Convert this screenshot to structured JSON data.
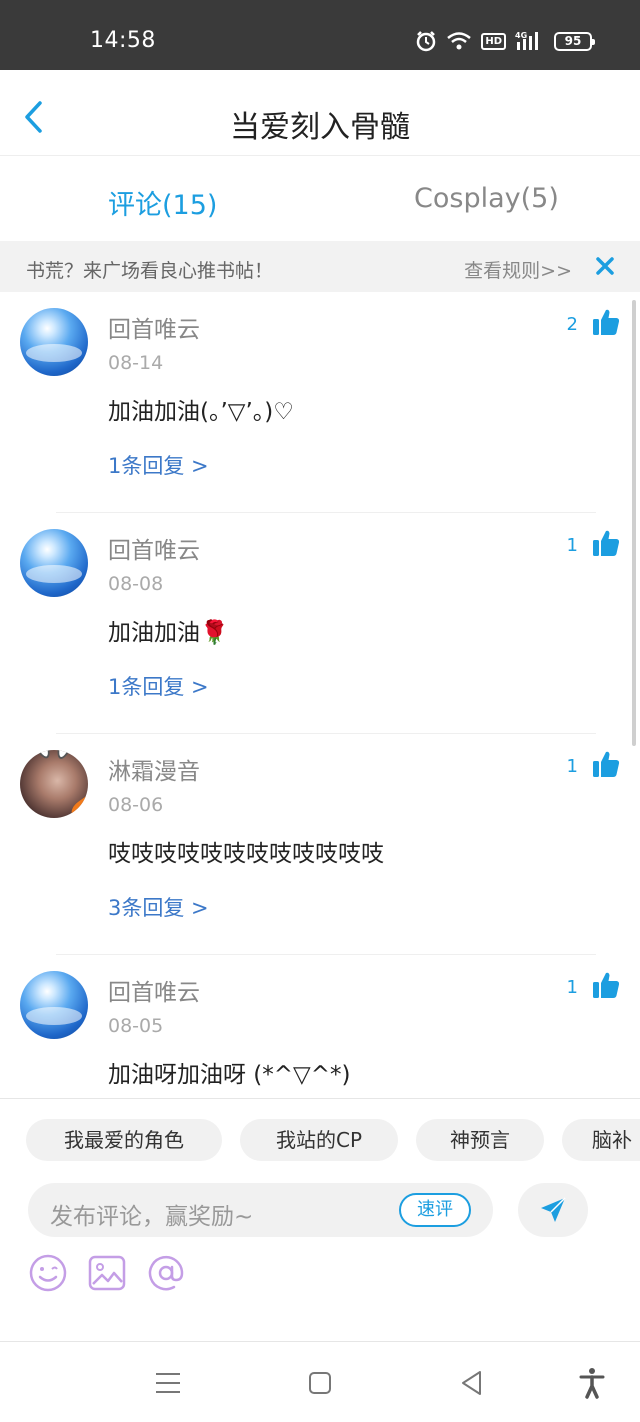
{
  "status_bar": {
    "time": "14:58",
    "battery": "95",
    "network": "4G",
    "hd": "HD"
  },
  "header": {
    "title": "当爱刻入骨髓"
  },
  "tabs": [
    {
      "label": "评论(15)",
      "active": true
    },
    {
      "label": "Cosplay(5)",
      "active": false
    }
  ],
  "notice": {
    "text": "书荒？来广场看良心推书帖！",
    "link": "查看规则>>"
  },
  "comments": [
    {
      "user": "回首唯云",
      "date": "08-14",
      "text": "加油加油(。’▽’。)♡",
      "replies": "1条回复 >",
      "likes": "2",
      "avatar": "sky"
    },
    {
      "user": "回首唯云",
      "date": "08-08",
      "text": "加油加油🌹",
      "replies": "1条回复 >",
      "likes": "1",
      "avatar": "sky"
    },
    {
      "user": "淋霜漫音",
      "date": "08-06",
      "text": "吱吱吱吱吱吱吱吱吱吱吱吱",
      "replies": "3条回复 >",
      "likes": "1",
      "avatar": "photo"
    },
    {
      "user": "回首唯云",
      "date": "08-05",
      "text": "加油呀加油呀 (*^▽^*)",
      "replies": "",
      "likes": "1",
      "avatar": "sky"
    }
  ],
  "quick_topics": [
    "我最爱的角色",
    "我站的CP",
    "神预言",
    "脑补"
  ],
  "composer": {
    "placeholder": "发布评论，赢奖励~",
    "quick_label": "速评"
  },
  "colors": {
    "accent": "#1c9ee0",
    "reply_link": "#3c78c8",
    "tool_purple": "#c49ee6"
  }
}
